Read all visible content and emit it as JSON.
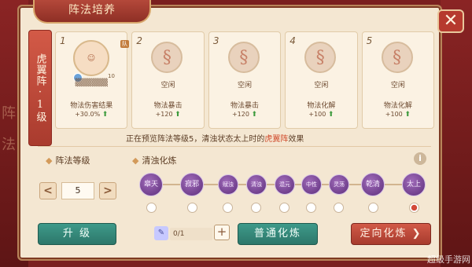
{
  "window": {
    "title": "阵法培养",
    "close_glyph": "✕"
  },
  "formation": {
    "label": "虎翼阵·1级"
  },
  "slots": [
    {
      "num": "1",
      "occupied": true,
      "name": "▒▒▒▒▒▒",
      "stat": "物法伤害结果",
      "value": "+30.0%",
      "level_tag": "队",
      "level": "10"
    },
    {
      "num": "2",
      "occupied": false,
      "name": "空闲",
      "stat": "物法暴击",
      "value": "+120"
    },
    {
      "num": "3",
      "occupied": false,
      "name": "空闲",
      "stat": "物法暴击",
      "value": "+120"
    },
    {
      "num": "4",
      "occupied": false,
      "name": "空闲",
      "stat": "物法化解",
      "value": "+100"
    },
    {
      "num": "5",
      "occupied": false,
      "name": "空闲",
      "stat": "物法化解",
      "value": "+100"
    }
  ],
  "preview": {
    "prefix": "正在预览阵法等级5，清浊状态太上时的",
    "highlight": "虎翼阵",
    "suffix": "效果"
  },
  "level_section": {
    "label": "阵法等级",
    "value": "5",
    "dec": "<",
    "inc": ">"
  },
  "refine_section": {
    "label": "清浊化炼"
  },
  "nodes": [
    {
      "label": "皋天",
      "selected": false
    },
    {
      "label": "寂邪",
      "selected": false
    },
    {
      "label": "赋浊",
      "selected": false
    },
    {
      "label": "清浊",
      "selected": false
    },
    {
      "label": "混元",
      "selected": false
    },
    {
      "label": "中性",
      "selected": false
    },
    {
      "label": "灵荡",
      "selected": false
    },
    {
      "label": "乾清",
      "selected": false
    },
    {
      "label": "太上",
      "selected": true
    }
  ],
  "buttons": {
    "upgrade": "升 级",
    "normal_refine": "普通化炼",
    "targeted_refine": "定向化炼 ❯"
  },
  "material": {
    "count": "0/1",
    "plus": "+"
  },
  "info_glyph": "i",
  "watermark": "超级手游网"
}
